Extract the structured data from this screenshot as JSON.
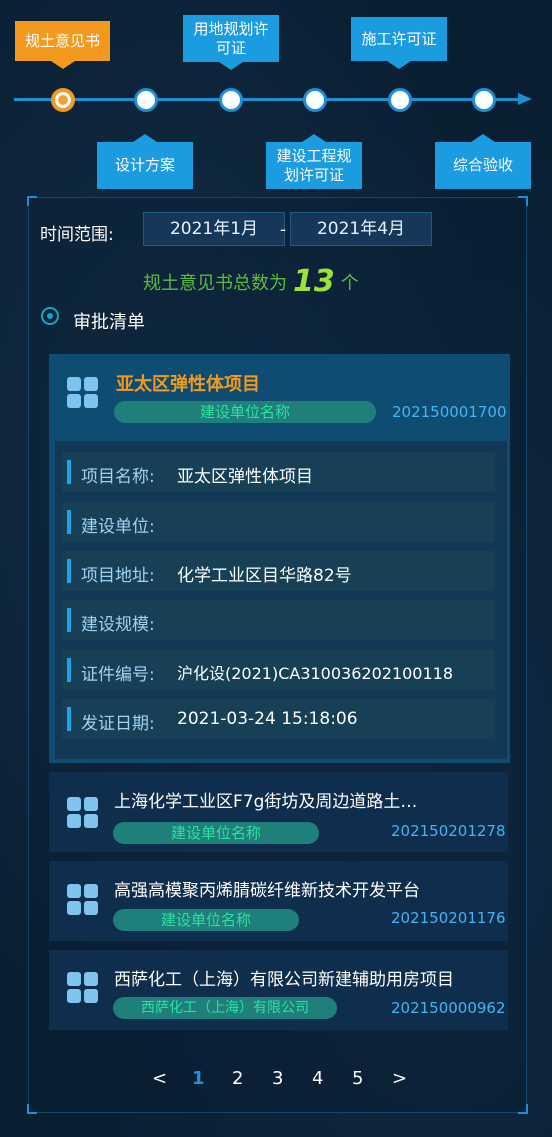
{
  "timeline": {
    "steps": [
      {
        "label": "规土意见书",
        "active": true
      },
      {
        "label": "设计方案"
      },
      {
        "label": "用地规划许可证"
      },
      {
        "label": "建设工程规划许可证"
      },
      {
        "label": "施工许可证"
      },
      {
        "label": "综合验收"
      }
    ],
    "label_lines": {
      "s3a": "用地规划许",
      "s3b": "可证",
      "s4a": "建设工程规",
      "s4b": "划许可证"
    }
  },
  "filter": {
    "label": "时间范围:",
    "start": "2021年1月",
    "separator": "-",
    "end": "2021年4月"
  },
  "summary": {
    "prefix": "规土意见书总数为",
    "count": "13",
    "suffix": "个"
  },
  "section_title": "审批清单",
  "expanded": {
    "title": "亚太区弹性体项目",
    "tag": "建设单位名称",
    "code": "202150001700",
    "fields": [
      {
        "key": "项目名称:",
        "value": "亚太区弹性体项目"
      },
      {
        "key": "建设单位:",
        "value": ""
      },
      {
        "key": "项目地址:",
        "value": "化学工业区目华路82号"
      },
      {
        "key": "建设规模:",
        "value": ""
      },
      {
        "key": "证件编号:",
        "value": "沪化设(2021)CA310036202100118"
      },
      {
        "key": "发证日期:",
        "value": "2021-03-24 15:18:06"
      }
    ]
  },
  "items": [
    {
      "title": "上海化学工业区F7g街坊及周边道路土…",
      "tag": "建设单位名称",
      "code": "202150201278"
    },
    {
      "title": "高强高模聚丙烯腈碳纤维新技术开发平台",
      "tag": "建设单位名称",
      "code": "202150201176"
    },
    {
      "title": "西萨化工（上海）有限公司新建辅助用房项目",
      "tag": "西萨化工（上海）有限公司",
      "code": "202150000962"
    }
  ],
  "pager": {
    "prev": "<",
    "pages": [
      "1",
      "2",
      "3",
      "4",
      "5"
    ],
    "current": "1",
    "next": ">"
  },
  "colors": {
    "accent": "#1b9be0",
    "active_step": "#f39a1e",
    "count": "#9be23a",
    "tag_text": "#2fe0a0"
  }
}
